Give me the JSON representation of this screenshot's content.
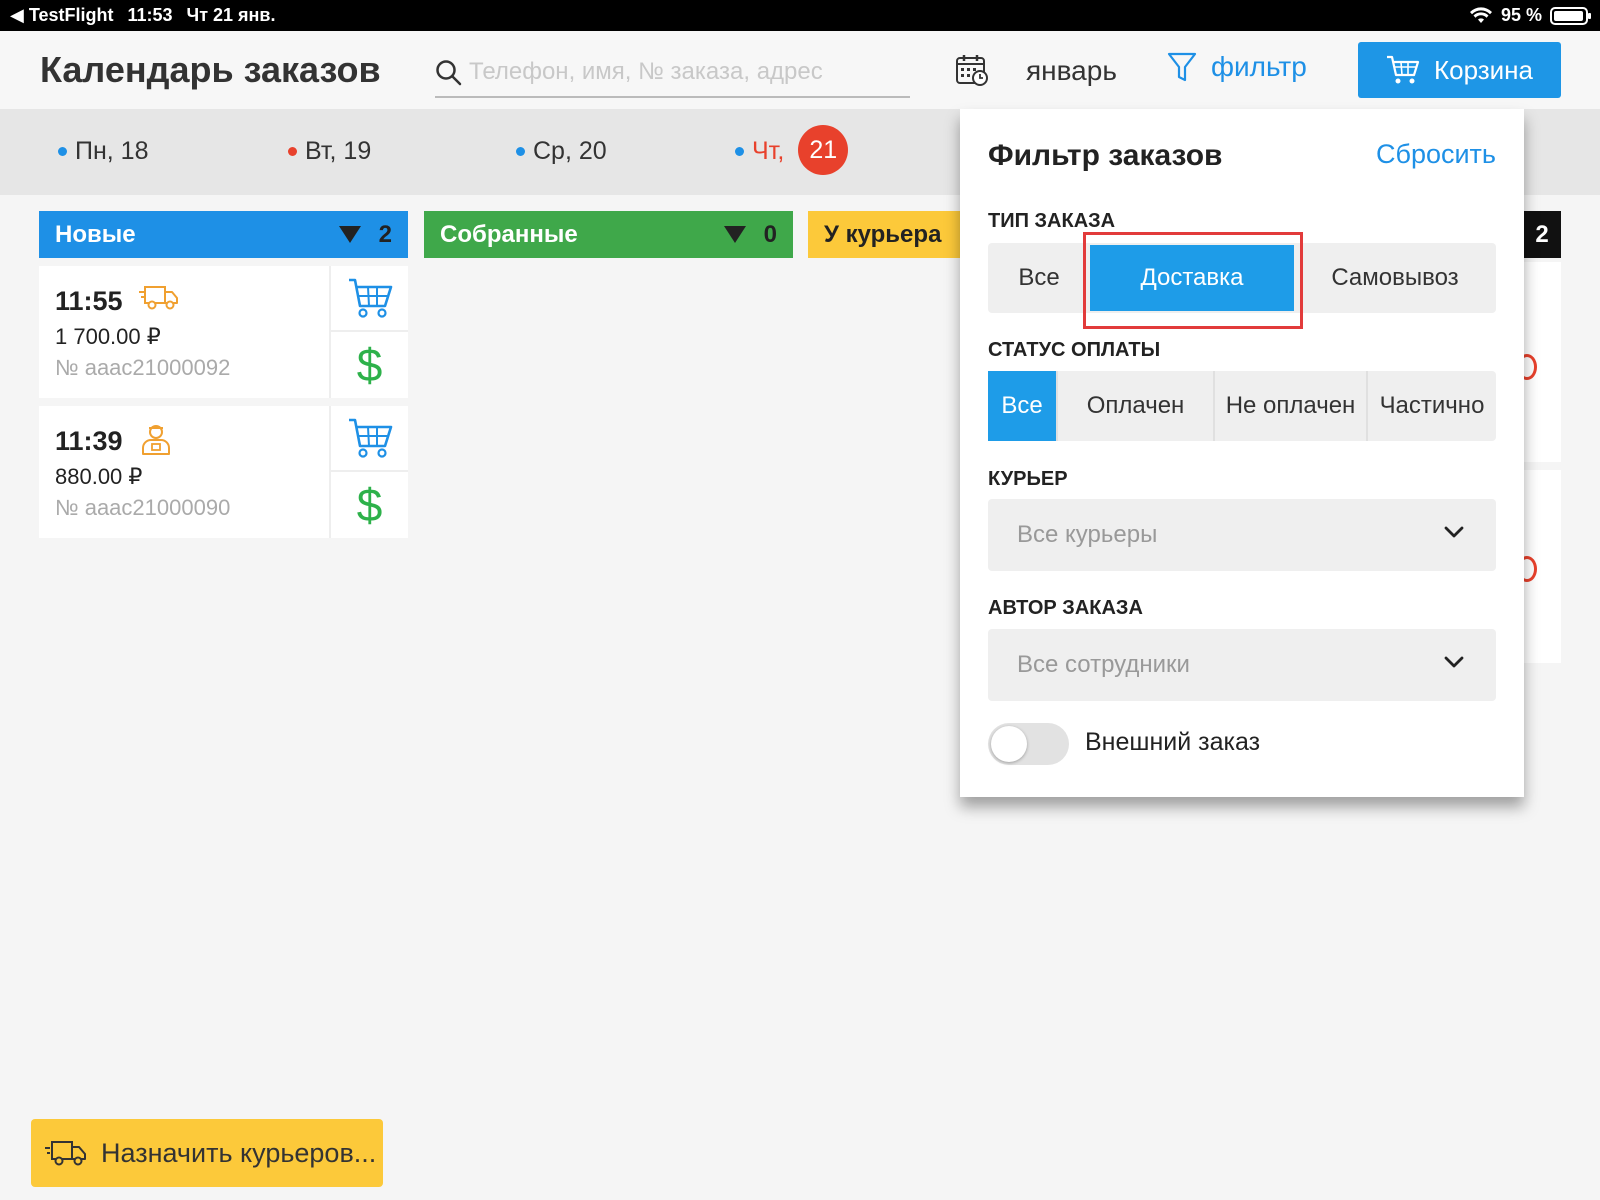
{
  "status_bar": {
    "back_app": "TestFlight",
    "time": "11:53",
    "date": "Чт 21 янв.",
    "battery": "95 %"
  },
  "header": {
    "title": "Календарь заказов",
    "search_placeholder": "Телефон, имя, № заказа, адрес",
    "month": "январь",
    "filter_label": "фильтр",
    "cart_label": "Корзина"
  },
  "days": [
    {
      "label": "Пн, 18",
      "dot_color": "#1e90e6"
    },
    {
      "label": "Вт, 19",
      "dot_color": "#e8412c"
    },
    {
      "label": "Ср, 20",
      "dot_color": "#1e90e6"
    },
    {
      "label": "Чт,",
      "today_number": "21",
      "dot_color": "#1e90e6",
      "label_color": "#e8412c"
    }
  ],
  "columns": [
    {
      "title": "Новые",
      "count": "2",
      "color": "#1e90e6"
    },
    {
      "title": "Собранные",
      "count": "0",
      "color": "#3fa84a"
    },
    {
      "title": "У курьера",
      "color": "#fcc93a"
    }
  ],
  "right_column_count": "2",
  "orders": [
    {
      "time": "11:55",
      "price": "1 700.00 ₽",
      "number": "№ aaac21000092",
      "type_icon": "delivery-truck-icon"
    },
    {
      "time": "11:39",
      "price": "880.00 ₽",
      "number": "№ aaac21000090",
      "type_icon": "courier-person-icon"
    }
  ],
  "dollar_symbol": "$",
  "assign_button": "Назначить курьеров...",
  "filter_popup": {
    "title": "Фильтр заказов",
    "reset": "Сбросить",
    "order_type": {
      "label": "ТИП ЗАКАЗА",
      "options": [
        "Все",
        "Доставка",
        "Самовывоз"
      ],
      "selected": "Доставка"
    },
    "payment_status": {
      "label": "СТАТУС ОПЛАТЫ",
      "options": [
        "Все",
        "Оплачен",
        "Не оплачен",
        "Частично"
      ],
      "selected": "Все"
    },
    "courier": {
      "label": "КУРЬЕР",
      "value": "Все курьеры"
    },
    "author": {
      "label": "АВТОР ЗАКАЗА",
      "value": "Все сотрудники"
    },
    "external_order": {
      "label": "Внешний заказ",
      "enabled": false
    }
  },
  "colors": {
    "accent": "#1e96e6",
    "green": "#2db14a",
    "yellow": "#fcc93a",
    "red": "#e8412c",
    "highlight_box": "#e23b3b"
  }
}
